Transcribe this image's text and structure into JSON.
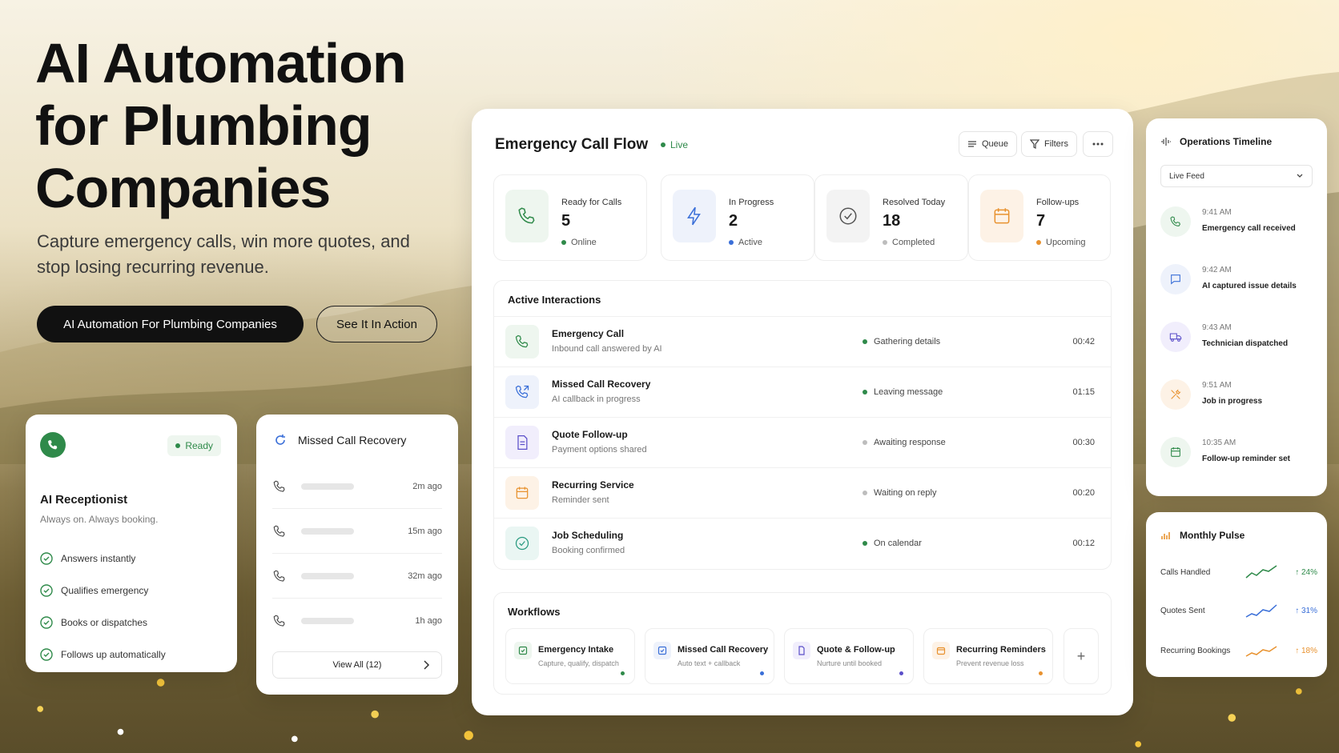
{
  "hero": {
    "title": "AI Automation for Plumbing Companies",
    "subtitle": "Capture emergency calls, win more quotes, and stop losing recurring revenue.",
    "primary_cta": "AI Automation For Plumbing Companies",
    "secondary_cta": "See It In Action"
  },
  "receptionist": {
    "badge": "Ready",
    "title": "AI Receptionist",
    "subtitle": "Always on. Always booking.",
    "features": [
      "Answers instantly",
      "Qualifies emergency",
      "Books or dispatches",
      "Follows up automatically"
    ]
  },
  "missed": {
    "title": "Missed Call Recovery",
    "items": [
      "2m ago",
      "15m ago",
      "32m ago",
      "1h ago"
    ],
    "view_all": "View All (12)"
  },
  "dashboard": {
    "title": "Emergency Call Flow",
    "live": "Live",
    "queue": "Queue",
    "filters": "Filters",
    "stats": [
      {
        "label": "Ready for Calls",
        "value": "5",
        "status": "Online",
        "color": "#2f8a4a"
      },
      {
        "label": "In Progress",
        "value": "2",
        "status": "Active",
        "color": "#3a6fd8"
      },
      {
        "label": "Resolved Today",
        "value": "18",
        "status": "Completed",
        "color": "#9a9a9a"
      },
      {
        "label": "Follow-ups",
        "value": "7",
        "status": "Upcoming",
        "color": "#e8922f"
      }
    ],
    "interactions_title": "Active Interactions",
    "interactions": [
      {
        "name": "Emergency Call",
        "desc": "Inbound call answered by AI",
        "status": "Gathering details",
        "time": "00:42",
        "color": "#2f8a4a"
      },
      {
        "name": "Missed Call Recovery",
        "desc": "AI callback in progress",
        "status": "Leaving message",
        "time": "01:15",
        "color": "#2f8a4a"
      },
      {
        "name": "Quote Follow-up",
        "desc": "Payment options shared",
        "status": "Awaiting response",
        "time": "00:30",
        "color": "#bdbdbd"
      },
      {
        "name": "Recurring Service",
        "desc": "Reminder sent",
        "status": "Waiting on reply",
        "time": "00:20",
        "color": "#bdbdbd"
      },
      {
        "name": "Job Scheduling",
        "desc": "Booking confirmed",
        "status": "On calendar",
        "time": "00:12",
        "color": "#2f8a4a"
      }
    ],
    "workflows_title": "Workflows",
    "workflows": [
      {
        "name": "Emergency Intake",
        "desc": "Capture, qualify, dispatch",
        "color": "#2f8a4a"
      },
      {
        "name": "Missed Call Recovery",
        "desc": "Auto text + callback",
        "color": "#3a6fd8"
      },
      {
        "name": "Quote & Follow-up",
        "desc": "Nurture until booked",
        "color": "#5b4fc9"
      },
      {
        "name": "Recurring Reminders",
        "desc": "Prevent revenue loss",
        "color": "#e8922f"
      }
    ],
    "add": "+"
  },
  "operations": {
    "title": "Operations Timeline",
    "select": "Live Feed",
    "events": [
      {
        "time": "9:41 AM",
        "event": "Emergency call received"
      },
      {
        "time": "9:42 AM",
        "event": "AI captured issue details"
      },
      {
        "time": "9:43 AM",
        "event": "Technician dispatched"
      },
      {
        "time": "9:51 AM",
        "event": "Job in progress"
      },
      {
        "time": "10:35 AM",
        "event": "Follow-up reminder set"
      }
    ]
  },
  "pulse": {
    "title": "Monthly Pulse",
    "rows": [
      {
        "label": "Calls Handled",
        "change": "↑ 24%",
        "color": "#2f8a4a"
      },
      {
        "label": "Quotes Sent",
        "change": "↑ 31%",
        "color": "#3a6fd8"
      },
      {
        "label": "Recurring Bookings",
        "change": "↑ 18%",
        "color": "#e8922f"
      }
    ]
  }
}
